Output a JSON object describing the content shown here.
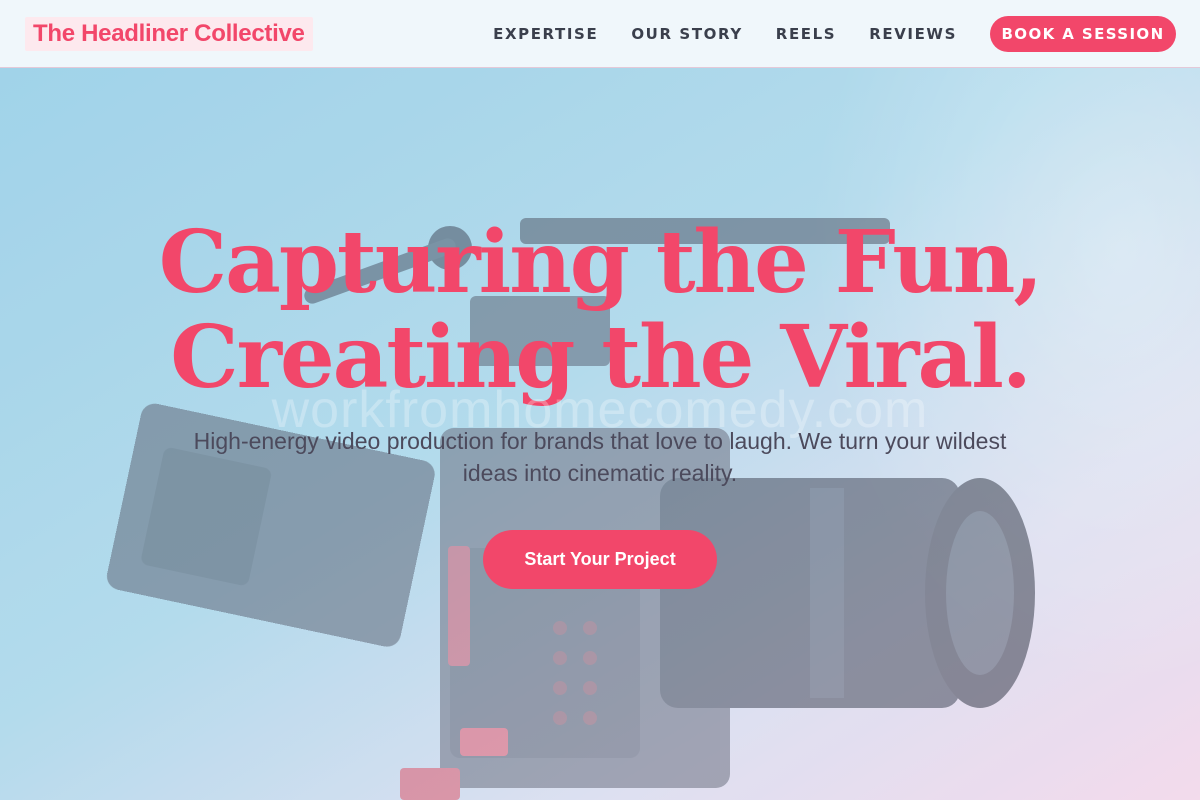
{
  "header": {
    "logo": "The Headliner Collective",
    "nav": [
      "EXPERTISE",
      "OUR STORY",
      "REELS",
      "REVIEWS"
    ],
    "cta_label": "BOOK A SESSION"
  },
  "hero": {
    "headline_line1": "Capturing the Fun,",
    "headline_line2": "Creating the Viral.",
    "watermark": "workfromhomecomedy.com",
    "subtitle": "High-energy video production for brands that love to laugh. We turn your wildest ideas into cinematic reality.",
    "cta_label": "Start Your Project",
    "background_image": "video-camera-rig-photo"
  },
  "colors": {
    "accent": "#f2476a",
    "header_bg": "#f0f7fb",
    "nav_text": "#3a3f4c",
    "subtitle_text": "#4c4a5c",
    "hero_gradient_left": "#9dd0e6",
    "hero_gradient_right": "#f0d8ec"
  }
}
